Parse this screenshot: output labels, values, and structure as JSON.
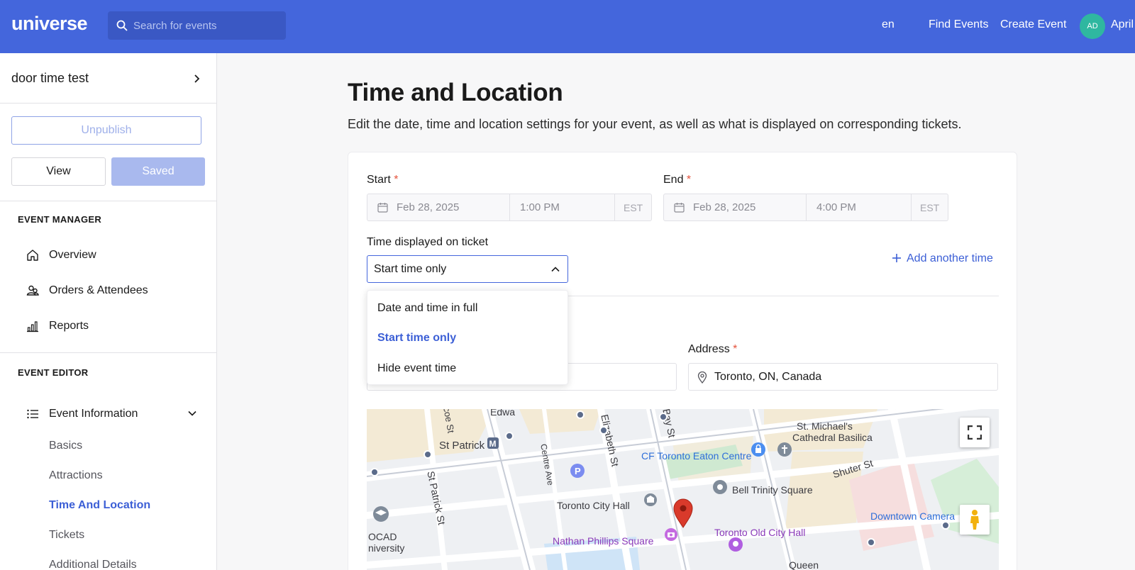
{
  "header": {
    "logo": "universe",
    "search_placeholder": "Search for events",
    "lang": "en",
    "find_events": "Find Events",
    "create_event": "Create Event",
    "avatar_initials": "AD",
    "user_name": "April"
  },
  "sidebar": {
    "event_name": "door time test",
    "unpublish": "Unpublish",
    "view": "View",
    "saved": "Saved",
    "manager_heading": "EVENT MANAGER",
    "manager_items": [
      "Overview",
      "Orders & Attendees",
      "Reports"
    ],
    "editor_heading": "EVENT EDITOR",
    "event_information": "Event Information",
    "sub_items": [
      "Basics",
      "Attractions",
      "Time And Location",
      "Tickets",
      "Additional Details"
    ],
    "active_sub_item": "Time And Location"
  },
  "main": {
    "title": "Time and Location",
    "description": "Edit the date, time and location settings for your event, as well as what is displayed on corresponding tickets.",
    "start_label": "Start",
    "end_label": "End",
    "required_mark": "*",
    "start": {
      "date": "Feb 28, 2025",
      "time": "1:00 PM",
      "tz": "EST"
    },
    "end": {
      "date": "Feb 28, 2025",
      "time": "4:00 PM",
      "tz": "EST"
    },
    "time_displayed_label": "Time displayed on ticket",
    "time_displayed_value": "Start time only",
    "add_another_time": "Add another time",
    "dropdown_options": [
      "Date and time in full",
      "Start time only",
      "Hide event time"
    ],
    "selected_option": "Start time only",
    "address_label": "Address",
    "address_value": "Toronto, ON, Canada"
  },
  "map": {
    "labels": {
      "st_michaels": "St. Michael's",
      "cathedral": "Cathedral Basilica",
      "st_patrick": "St Patrick",
      "cf_toronto": "CF Toronto Eaton Centre",
      "shuter": "Shuter St",
      "bell_trinity": "Bell Trinity Square",
      "toronto_city_hall": "Toronto City Hall",
      "downtown_camera": "Downtown Camera",
      "nathan_phillips": "Nathan Phillips Square",
      "toronto_old_city_hall": "Toronto Old City Hall",
      "ocad": "OCAD",
      "niversity": "niversity",
      "queen": "Queen",
      "elizabeth_st": "Elizabeth St",
      "bay_st": "Bay St",
      "centre_ave": "Centre Ave",
      "st_patrick_st": "St Patrick St",
      "edward": "Edwa",
      "coe_st": "coe St"
    },
    "colors": {
      "road": "#ffffff",
      "block": "#f3ead5",
      "park": "#cfe9d1",
      "pin": "#d93a2b",
      "accent": "#4466dc"
    }
  }
}
